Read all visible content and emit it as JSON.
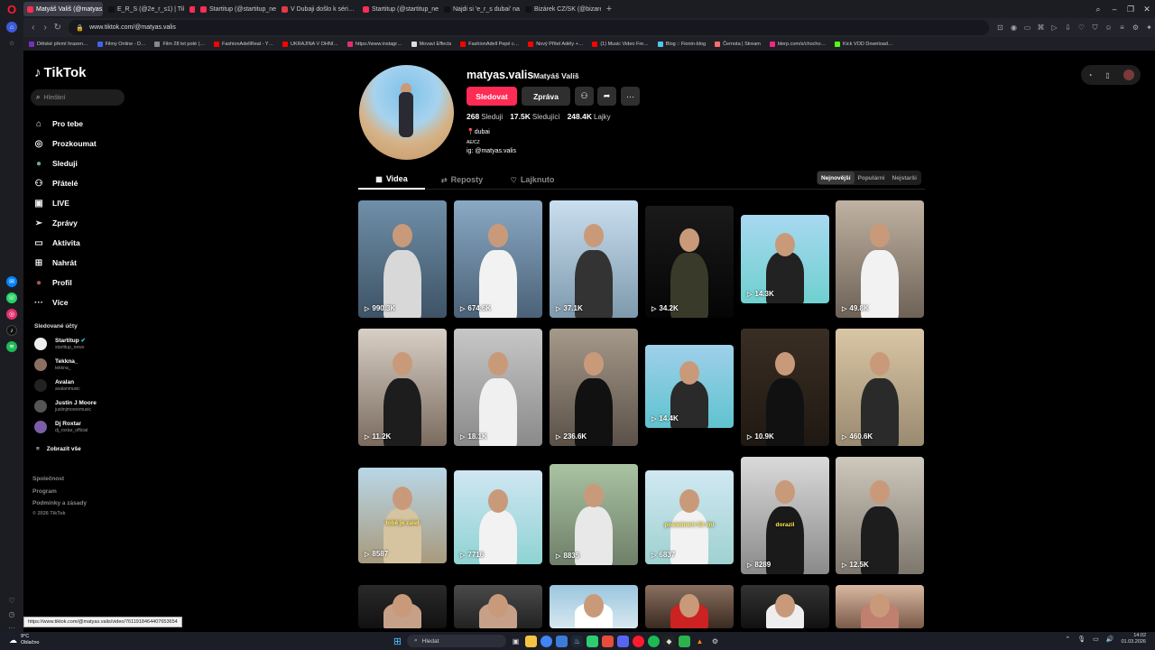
{
  "browser": {
    "tabs": [
      {
        "label": "Matyáš Vališ (@matyas.vali…",
        "color": "#ff2d55",
        "active": true
      },
      {
        "label": "E_R_S (@2e_r_s1) | TikTok",
        "color": "#111111",
        "active": false
      },
      {
        "label": "",
        "color": "#ff2d55",
        "active": false
      },
      {
        "label": "Startitup (@startitup_new…",
        "color": "#ff2d55",
        "active": false
      },
      {
        "label": "V Dubaji došlo k séri…",
        "color": "#e63946",
        "active": false
      },
      {
        "label": "Startitup (@startitup_new…",
        "color": "#ff2d55",
        "active": false
      },
      {
        "label": "Najdi si 'e_r_s dubai' na T…",
        "color": "#111111",
        "active": false
      },
      {
        "label": "Bizárek CZ/SK (@bizarek…",
        "color": "#111111",
        "active": false
      }
    ],
    "new_tab": "+",
    "url": "www.tiktok.com/@matyas.valis",
    "bookmarks": [
      {
        "label": "Dětské přemí hrazen…",
        "color": "#7b2cbf"
      },
      {
        "label": "Filmy Online - D…",
        "color": "#4361ee"
      },
      {
        "label": "Film 28 let poté (…",
        "color": "#888888"
      },
      {
        "label": "FashionAdellReal - Y…",
        "color": "#ff0000"
      },
      {
        "label": "UKRAJINA V OHNI…",
        "color": "#ff0000"
      },
      {
        "label": "https://www.instagr…",
        "color": "#e1306c"
      },
      {
        "label": "Movavi Effects",
        "color": "#dddddd"
      },
      {
        "label": "FashionAdell Pepé c…",
        "color": "#ff0000"
      },
      {
        "label": "Nový Přítel Adély +…",
        "color": "#ff0000"
      },
      {
        "label": "(1) Music Video Fre…",
        "color": "#ff0000"
      },
      {
        "label": "Blog :: Fionin-blog",
        "color": "#4cc9f0"
      },
      {
        "label": "Černota | Stream",
        "color": "#ff6b6b"
      },
      {
        "label": "blerp.com/s/chocho…",
        "color": "#f72585"
      },
      {
        "label": "Kick VOD Download…",
        "color": "#53fc18"
      }
    ],
    "status_url": "https://www.tiktok.com/@matyas.valis/video/7611918464407653654"
  },
  "sidebar": {
    "logo": "TikTok",
    "search_placeholder": "Hledání",
    "menu": [
      {
        "label": "Pro tebe",
        "icon": "home-icon",
        "glyph": "⌂"
      },
      {
        "label": "Prozkoumat",
        "icon": "compass-icon",
        "glyph": "◎"
      },
      {
        "label": "Sleduji",
        "icon": "following-avatar-icon",
        "glyph": "●"
      },
      {
        "label": "Přátelé",
        "icon": "friends-icon",
        "glyph": "⚇"
      },
      {
        "label": "LIVE",
        "icon": "live-icon",
        "glyph": "▣"
      },
      {
        "label": "Zprávy",
        "icon": "messages-icon",
        "glyph": "➢"
      },
      {
        "label": "Aktivita",
        "icon": "activity-icon",
        "glyph": "▭"
      },
      {
        "label": "Nahrát",
        "icon": "upload-icon",
        "glyph": "⊞"
      },
      {
        "label": "Profil",
        "icon": "profile-avatar-icon",
        "glyph": "●"
      },
      {
        "label": "Více",
        "icon": "more-icon",
        "glyph": "···"
      }
    ],
    "following_title": "Sledované účty",
    "following": [
      {
        "name": "Startitup",
        "handle": "startitup_news",
        "color": "#eeeeee",
        "verified": "✔"
      },
      {
        "name": "Tekkna_",
        "handle": "tekkna_",
        "color": "#8d6e63",
        "verified": ""
      },
      {
        "name": "Avalan",
        "handle": "avalanmusic",
        "color": "#222222",
        "verified": ""
      },
      {
        "name": "Justin J Moore",
        "handle": "justinjmooremusic",
        "color": "#555555",
        "verified": ""
      },
      {
        "name": "Dj Roxtar",
        "handle": "dj_roxtar_official",
        "color": "#7b5ea7",
        "verified": ""
      }
    ],
    "show_all": "Zobrazit vše",
    "footer": [
      "Společnost",
      "Program",
      "Podmínky a zásady",
      "© 2026 TikTok"
    ]
  },
  "profile": {
    "username": "matyas.valis",
    "display_name": "Matyáš Vališ",
    "follow_button": "Sledovat",
    "message_button": "Zpráva",
    "following_count": "268",
    "following_label": "Sleduji",
    "followers_count": "17.5K",
    "followers_label": "Sledující",
    "likes_count": "248.4K",
    "likes_label": "Lajky",
    "bio_location": "dubai",
    "bio_region": "AE/CZ",
    "bio_ig": "ig: @matyas.valis",
    "tabs": [
      {
        "label": "Videa",
        "icon": "grid-icon",
        "glyph": "▦"
      },
      {
        "label": "Reposty",
        "icon": "repost-icon",
        "glyph": "⇄"
      },
      {
        "label": "Lajknuto",
        "icon": "heart-outline-icon",
        "glyph": "♡"
      }
    ],
    "sort": [
      "Nejnovější",
      "Populární",
      "Nejstarší"
    ]
  },
  "videos": [
    {
      "views": "990.3K",
      "caption": "",
      "bg1": "#6f8fa8",
      "bg2": "#3e5366",
      "person": "#d8d8d8"
    },
    {
      "views": "674.6K",
      "caption": "",
      "bg1": "#8aa9c4",
      "bg2": "#4b6278",
      "person": "#f2f2f2"
    },
    {
      "views": "37.1K",
      "caption": "",
      "bg1": "#c9dff0",
      "bg2": "#7e99ad",
      "person": "#333333"
    },
    {
      "views": "34.2K",
      "caption": "",
      "bg1": "#1a1a1a",
      "bg2": "#050505",
      "person": "#3a3a2a"
    },
    {
      "views": "14.3K",
      "caption": "",
      "bg1": "#a8d8f0",
      "bg2": "#6fd0cf",
      "person": "#222222"
    },
    {
      "views": "49.8K",
      "caption": "",
      "bg1": "#bfb2a2",
      "bg2": "#6e6257",
      "person": "#f2f2f2"
    },
    {
      "views": "11.2K",
      "caption": "",
      "bg1": "#d8cfc6",
      "bg2": "#7a6b5e",
      "person": "#1d1d1d"
    },
    {
      "views": "18.1K",
      "caption": "",
      "bg1": "#c7c7c7",
      "bg2": "#8a8a8a",
      "person": "#f0f0f0"
    },
    {
      "views": "236.6K",
      "caption": "",
      "bg1": "#a5998a",
      "bg2": "#5b5148",
      "person": "#111111"
    },
    {
      "views": "14.4K",
      "caption": "",
      "bg1": "#9fd0ea",
      "bg2": "#5fc3cf",
      "person": "#2a2a2a"
    },
    {
      "views": "10.9K",
      "caption": "",
      "bg1": "#3a2e24",
      "bg2": "#1f1812",
      "person": "#111111"
    },
    {
      "views": "460.6K",
      "caption": "",
      "bg1": "#d9c6a5",
      "bg2": "#9a8a70",
      "person": "#2a2a2a"
    },
    {
      "views": "8587",
      "caption": "tobě je zalet",
      "bg1": "#b9d7e8",
      "bg2": "#a89a7d",
      "person": "#d6c3a0"
    },
    {
      "views": "7716",
      "caption": "",
      "bg1": "#cfe6f2",
      "bg2": "#8fd3d3",
      "person": "#f2f2f2"
    },
    {
      "views": "8835",
      "caption": "",
      "bg1": "#a9c3a2",
      "bg2": "#6f7f69",
      "person": "#e8e8e8"
    },
    {
      "views": "6837",
      "caption": "posledních 50 dní",
      "bg1": "#d0e8f2",
      "bg2": "#9fd1d0",
      "person": "#f2f2f2"
    },
    {
      "views": "8289",
      "caption": "dorazil",
      "bg1": "#dadada",
      "bg2": "#8a8a8a",
      "person": "#1a1a1a"
    },
    {
      "views": "12.5K",
      "caption": "",
      "bg1": "#cfc8bd",
      "bg2": "#7d766c",
      "person": "#1d1d1d"
    },
    {
      "views": "",
      "caption": "",
      "bg1": "#2a2a2a",
      "bg2": "#111111",
      "person": "#c7a08a"
    },
    {
      "views": "",
      "caption": "",
      "bg1": "#4a4a4a",
      "bg2": "#222222",
      "person": "#c7a08a"
    },
    {
      "views": "",
      "caption": "",
      "bg1": "#9ac6de",
      "bg2": "#d8e8f0",
      "person": "#ffffff"
    },
    {
      "views": "",
      "caption": "",
      "bg1": "#8a7060",
      "bg2": "#3a2a20",
      "person": "#cc2222"
    },
    {
      "views": "",
      "caption": "",
      "bg1": "#333333",
      "bg2": "#111111",
      "person": "#eeeeee"
    },
    {
      "views": "",
      "caption": "",
      "bg1": "#d9b8a0",
      "bg2": "#7a5a4a",
      "person": "#c08070"
    }
  ],
  "taskbar": {
    "temp": "9°C",
    "weather": "Oblačno",
    "search": "Hledat",
    "time": "14:02",
    "date": "01.03.2026"
  }
}
